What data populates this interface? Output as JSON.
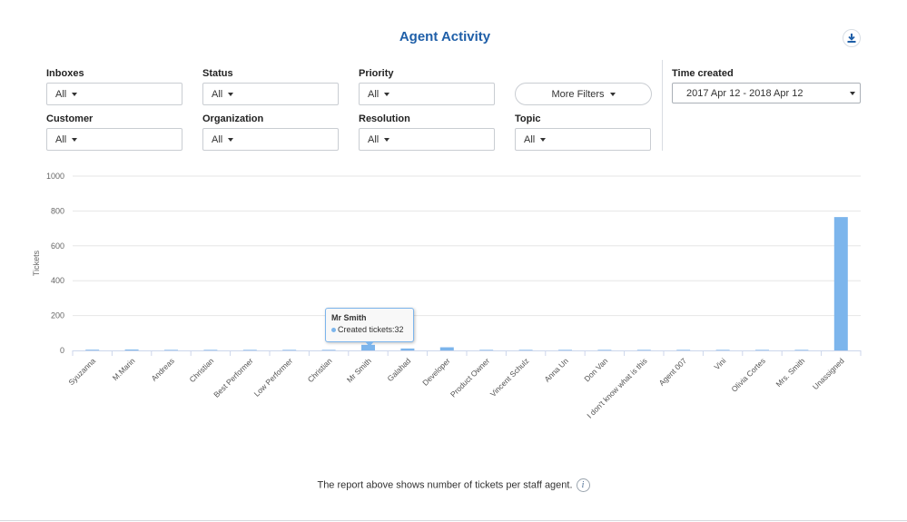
{
  "page": {
    "title": "Agent Activity",
    "footnote": "The report above shows number of tickets per staff agent.",
    "info_icon_glyph": "i"
  },
  "filters": {
    "inboxes": {
      "label": "Inboxes",
      "value": "All"
    },
    "status": {
      "label": "Status",
      "value": "All"
    },
    "priority": {
      "label": "Priority",
      "value": "All"
    },
    "customer": {
      "label": "Customer",
      "value": "All"
    },
    "organization": {
      "label": "Organization",
      "value": "All"
    },
    "resolution": {
      "label": "Resolution",
      "value": "All"
    },
    "topic": {
      "label": "Topic",
      "value": "All"
    },
    "more_filters_label": "More Filters",
    "time_created": {
      "label": "Time created",
      "value": "2017 Apr 12 - 2018 Apr 12"
    }
  },
  "tooltip": {
    "name": "Mr Smith",
    "series": "Created tickets",
    "separator": ":",
    "value": "32"
  },
  "icons": [
    "download-icon",
    "info-icon",
    "caret-down-icon"
  ],
  "colors": {
    "accent": "#1f5fa8",
    "bar": "#7cb5ec"
  },
  "chart_data": {
    "type": "bar",
    "ylabel": "Tickets",
    "xlabel": "",
    "ylim": [
      0,
      1000
    ],
    "yticks": [
      0,
      200,
      400,
      600,
      800,
      1000
    ],
    "grid": true,
    "series": [
      {
        "name": "Created tickets",
        "values": [
          4,
          5,
          1,
          1,
          1,
          1,
          1,
          32,
          11,
          18,
          1,
          1,
          1,
          1,
          1,
          1,
          1,
          1,
          1,
          765
        ]
      }
    ],
    "categories": [
      "Syuzanna",
      "M.Marin",
      "Andreas",
      "Christian",
      "Best Performer",
      "Low Performer",
      "Christian",
      "Mr Smith",
      "Galahad",
      "Developer",
      "Product Owner",
      "Vincent Schulz",
      "Anna Un",
      "Don Van",
      "I don't know what is this",
      "Agent 007",
      "Vini",
      "Olivia Cortes",
      "Mrs. Smith",
      "Unassigned"
    ]
  }
}
